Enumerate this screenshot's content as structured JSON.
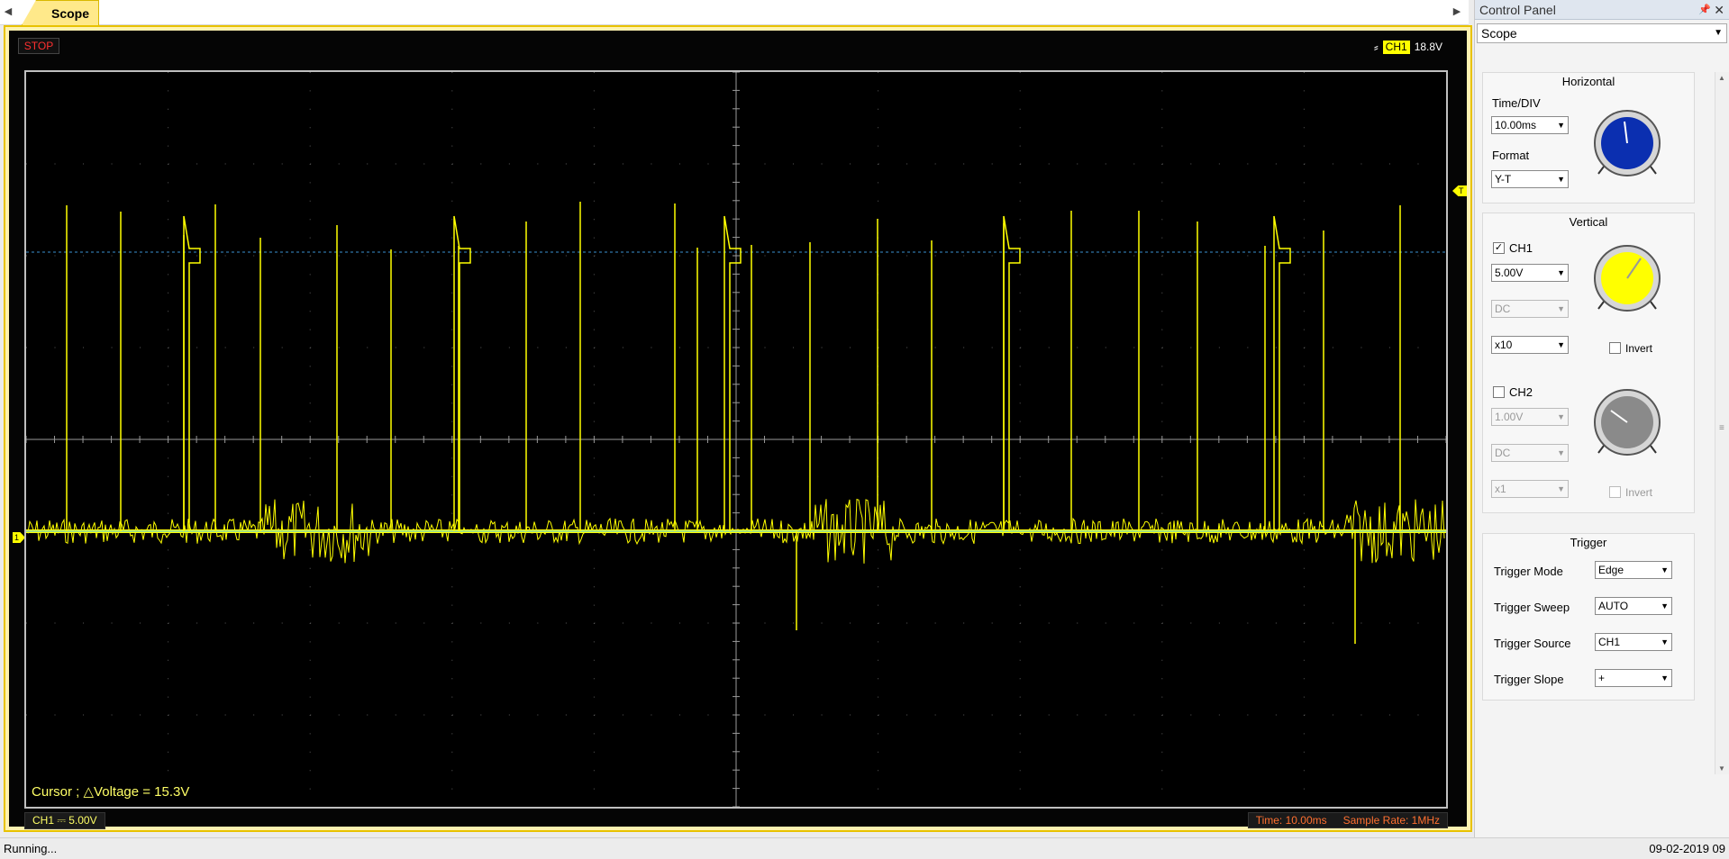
{
  "tabs": [
    {
      "label": "Scope"
    }
  ],
  "scope": {
    "run_state": "STOP",
    "trigger_channel": "CH1",
    "trigger_level": "18.8V",
    "cursor_readout": "Cursor ; △Voltage = 15.3V",
    "ch1_scale": "CH1 ⎓  5.00V",
    "time_div": "Time: 10.00ms",
    "sample_rate": "Sample Rate: 1MHz",
    "channel_marker": "1",
    "trigger_marker": "T",
    "trace_color": "#ffff00"
  },
  "control_panel": {
    "title": "Control Panel",
    "mode": "Scope",
    "horizontal": {
      "title": "Horizontal",
      "time_div_label": "Time/DIV",
      "time_div_value": "10.00ms",
      "format_label": "Format",
      "format_value": "Y-T",
      "knob_color": "#0b2fb0"
    },
    "vertical": {
      "title": "Vertical",
      "ch1": {
        "label": "CH1",
        "enabled": true,
        "volts": "5.00V",
        "coupling": "DC",
        "probe": "x10",
        "invert_label": "Invert",
        "knob_color": "#ffff00"
      },
      "ch2": {
        "label": "CH2",
        "enabled": false,
        "volts": "1.00V",
        "coupling": "DC",
        "probe": "x1",
        "invert_label": "Invert",
        "knob_color": "#8a8a8a"
      }
    },
    "trigger": {
      "title": "Trigger",
      "rows": [
        {
          "label": "Trigger Mode",
          "value": "Edge"
        },
        {
          "label": "Trigger Sweep",
          "value": "AUTO"
        },
        {
          "label": "Trigger Source",
          "value": "CH1"
        },
        {
          "label": "Trigger Slope",
          "value": "+"
        }
      ]
    }
  },
  "status": {
    "left": "Running...",
    "right": "09-02-2019  09"
  }
}
